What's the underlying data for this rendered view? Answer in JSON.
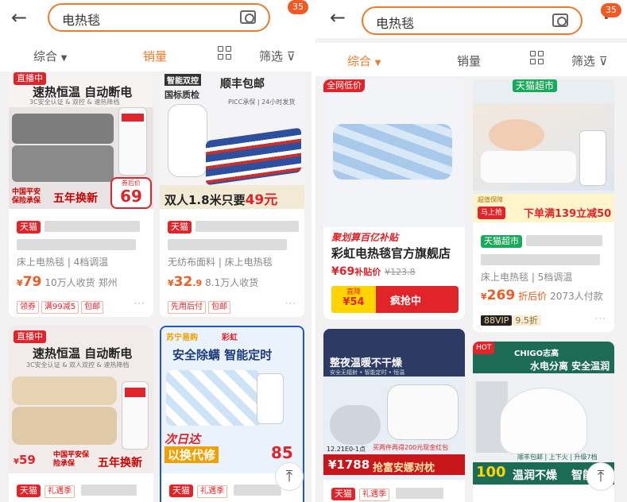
{
  "query": "电热毯",
  "notif_count": "35",
  "left": {
    "sort": [
      "综合",
      "销量",
      "筛选"
    ],
    "active_sort": "销量",
    "cards": [
      {
        "badge": "直播中",
        "headline": "速热恒温 自动断电",
        "sub": "3C安全认证 & 双控 & 速热降档",
        "bottom_red": "五年换新",
        "bottom_tag": "中国平安保险承保",
        "price_tag_label": "券后价",
        "price_tag": "69",
        "shop_tag": "天猫",
        "attr": "床上电热毯 | 4档调温",
        "price": "79",
        "sales": "10万人收货",
        "location": "郑州",
        "chips": [
          "领券",
          "满99减5",
          "包邮"
        ]
      },
      {
        "label1": "智能双控",
        "label2": "国标质检",
        "sf": "顺丰包邮",
        "picc": "PICC承保 | 24小时发货",
        "bottom": "双人1.8米只要",
        "bottom_price": "49元",
        "shop_tag": "天猫",
        "attr": "无纺布面料 | 床上电热毯",
        "price": "32",
        "price_dec": ".9",
        "sales": "8.1万人收货",
        "chips": [
          "先用后付",
          "包邮"
        ]
      },
      {
        "badge": "直播中",
        "headline": "速热恒温 自动断电",
        "sub": "3C安全认证 & 双人双控 & 速热降档",
        "price_left": "59",
        "bottom_tag": "中国平安保险承保",
        "bottom_red": "五年换新",
        "shop_tag": "天猫",
        "extra_tag": "礼遇季"
      },
      {
        "brand1": "苏宁易购",
        "brand2": "彩虹",
        "headline": "安全除螨 智能定时",
        "promo1": "次日达",
        "promo2": "以换代修",
        "price_right": "85",
        "shop_tag": "天猫",
        "extra_tag": "礼遇季"
      }
    ]
  },
  "right": {
    "sort": [
      "综合",
      "销量",
      "筛选"
    ],
    "active_sort": "综合",
    "cards": [
      {
        "badge": "全网低价",
        "promo_title": "聚划算百亿补贴",
        "shop_name": "彩虹电热毯官方旗舰店",
        "sub_price": "¥69",
        "sub_label": "补贴价",
        "sub_orig": "¥123.8",
        "direct_label": "直降",
        "direct_val": "¥54",
        "rush": "疯抢中"
      },
      {
        "top_label": "天猫超市",
        "promo_sub": "超值保障",
        "promo_tag": "马上抢",
        "promo_text": "下单满139立减50",
        "shop_tag": "天猫超市",
        "attr": "床上电热毯 | 5档调温",
        "price": "269",
        "price_note": "折后价",
        "sales": "2073人付款",
        "vip": "88VIP",
        "vip_disc": "9.5折"
      },
      {
        "headline": "整夜温暖不干燥",
        "sub": "安全无辐射 • 智能定时 • 恒温",
        "date_text": "12.21E0-1点",
        "deal": "买两件再得200元现金红包",
        "price": "¥1788",
        "cta": "抢富安娜对枕",
        "shop_tag": "天猫",
        "extra_tag": "礼遇季"
      },
      {
        "hot": "HOT",
        "brand": "CHIGO志高",
        "headline": "水电分离 安全温润",
        "feature": "顺丰包邮 | 上下火 | 升级7档",
        "bottom_num": "100",
        "bottom_text": "温润不燥",
        "bottom_text2": "智能"
      }
    ]
  },
  "colors": {
    "accent": "#f07a2a",
    "price": "#f05a24",
    "tmall": "#e0242a"
  }
}
